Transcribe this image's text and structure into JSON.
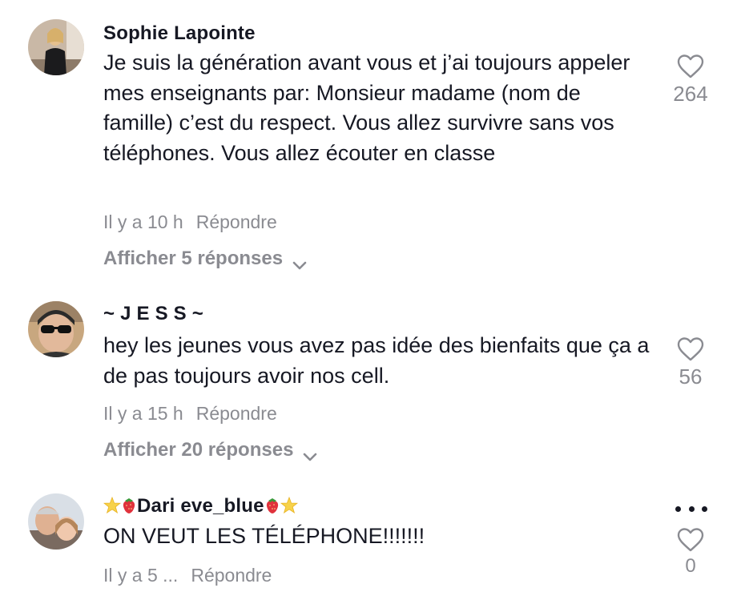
{
  "comments": [
    {
      "username": "Sophie Lapointe",
      "text": "Je suis la génération avant vous et j’ai toujours appeler mes enseignants par: Monsieur madame (nom de famille) c’est du respect. Vous allez survivre sans vos téléphones. Vous allez écouter en classe",
      "time": "Il y a 10 h",
      "reply_label": "Répondre",
      "replies_label": "Afficher 5 réponses",
      "likes": "264"
    },
    {
      "username": "~ J E S S ~",
      "text": "hey les jeunes vous avez pas idée des bienfaits que ça a de pas toujours avoir nos cell.",
      "time": "Il y a 15 h",
      "reply_label": "Répondre",
      "replies_label": "Afficher 20 réponses",
      "likes": "56"
    },
    {
      "username": "Dari eve_blue",
      "text": "ON VEUT LES TÉLÉPHONE!!!!!!!",
      "time": "Il y a 5 ...",
      "reply_label": "Répondre",
      "likes": "0"
    }
  ],
  "icons": {
    "like": "heart-outline-icon",
    "expand": "chevron-down-icon",
    "more": "more-dots-icon",
    "username_decor": [
      "star-icon",
      "strawberry-icon"
    ]
  },
  "colors": {
    "text": "#161823",
    "muted": "#8a8b91",
    "background": "#ffffff"
  }
}
